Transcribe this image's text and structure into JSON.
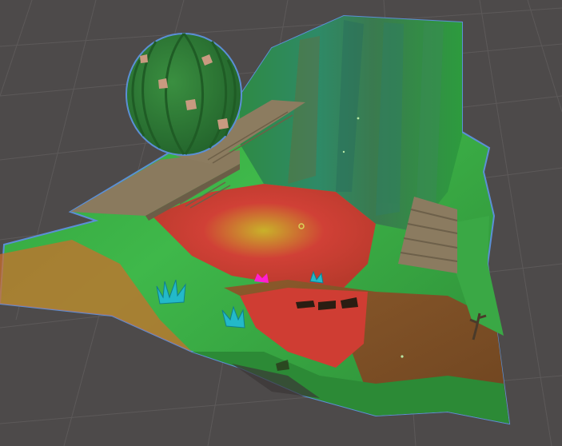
{
  "viewport": {
    "title": "",
    "background_color": "#4d4a4a",
    "grid_color": "#6a6666",
    "selection_outline_color": "#5b8fd6"
  },
  "scene": {
    "terrain_tile": {
      "selected": true,
      "vertex_colors": [
        "#2f9b3a",
        "#3fb84a",
        "#d04036",
        "#c9b12a",
        "#8b5a2b",
        "#2e8a67"
      ]
    },
    "objects": [
      {
        "kind": "cactus-ball",
        "color": "#2d7a33",
        "spine_color": "#1f5c25",
        "flower_color": "#c99a80"
      },
      {
        "kind": "wooden-bridge",
        "color": "#8a7a5e"
      },
      {
        "kind": "wooden-stairs",
        "color": "#8b7b60"
      },
      {
        "kind": "crystal-cluster",
        "color": "#23b9c9",
        "count": 3
      },
      {
        "kind": "pink-gem",
        "color": "#ff1fd3"
      },
      {
        "kind": "dead-bush",
        "color": "#4a3a2a"
      }
    ]
  }
}
